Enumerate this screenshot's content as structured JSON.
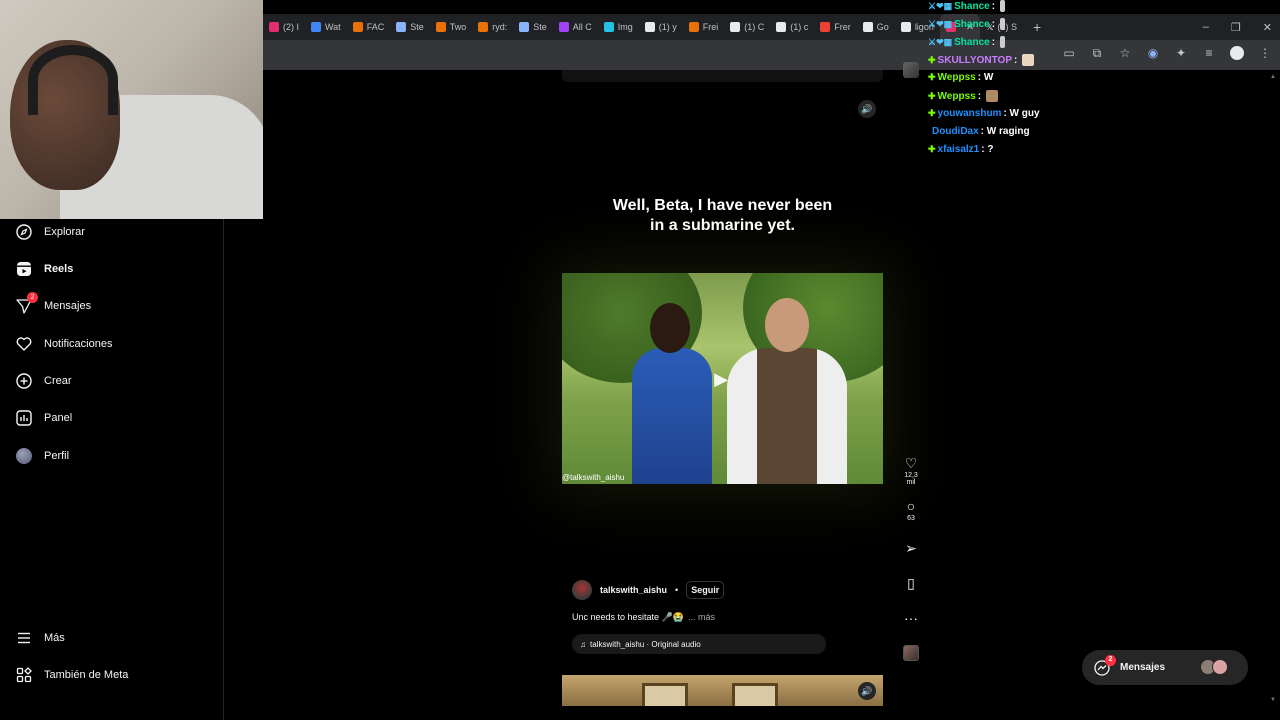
{
  "browser": {
    "tabs": [
      {
        "label": "(2) I",
        "color": "#e1306c"
      },
      {
        "label": "Wat",
        "color": "#4285f4"
      },
      {
        "label": "FAC",
        "color": "#e8710a"
      },
      {
        "label": "Ste",
        "color": "#8ab4f8"
      },
      {
        "label": "Two",
        "color": "#e8710a"
      },
      {
        "label": "ryd:",
        "color": "#e8710a"
      },
      {
        "label": "Ste",
        "color": "#8ab4f8"
      },
      {
        "label": "All C",
        "color": "#a142f4"
      },
      {
        "label": "Img",
        "color": "#24c1e0"
      },
      {
        "label": "(1) y",
        "color": "#e8eaed"
      },
      {
        "label": "Frei",
        "color": "#e8710a"
      },
      {
        "label": "(1) C",
        "color": "#e8eaed"
      },
      {
        "label": "(1) c",
        "color": "#e8eaed"
      },
      {
        "label": "Frer",
        "color": "#ea4335"
      },
      {
        "label": "Go",
        "color": "#e8eaed"
      },
      {
        "label": "ligon",
        "color": "#e8eaed"
      }
    ],
    "active_tab_color": "#e1306c",
    "last_tab": "(1) S",
    "new_tab": "+",
    "window_controls": [
      "–",
      "❐",
      "✕"
    ]
  },
  "sidebar": {
    "items": [
      {
        "label": "Explorar",
        "icon": "compass-icon"
      },
      {
        "label": "Reels",
        "icon": "reels-icon"
      },
      {
        "label": "Mensajes",
        "icon": "send-icon",
        "badge": "2"
      },
      {
        "label": "Notificaciones",
        "icon": "heart-icon"
      },
      {
        "label": "Crear",
        "icon": "plus-square-icon"
      },
      {
        "label": "Panel",
        "icon": "chart-icon"
      },
      {
        "label": "Perfil",
        "icon": "avatar"
      },
      {
        "label": "Más",
        "icon": "menu-icon"
      },
      {
        "label": "También de Meta",
        "icon": "meta-icon"
      }
    ]
  },
  "reel": {
    "caption_overlay": "Well, Beta, I have never been in a submarine yet.",
    "watermark": "@talkswith_aishu",
    "author": "talkswith_aishu",
    "follow": "Seguir",
    "separator": "•",
    "caption": "Unc needs to hesitate 🎤😭",
    "more": "... más",
    "audio": "talkswith_aishu · Original audio",
    "likes": "12,3 mil",
    "comments": "63"
  },
  "chat": {
    "lines": [
      {
        "user": "Shance",
        "color": "#00e5a0",
        "msg": ":"
      },
      {
        "user": "Shance",
        "color": "#00e5a0",
        "msg": ":"
      },
      {
        "user": "Shance",
        "color": "#00e5a0",
        "msg": ":"
      },
      {
        "user": "SKULLYONTOP",
        "color": "#c77dff",
        "msg": ":"
      },
      {
        "user": "Weppss",
        "color": "#7cfc00",
        "msg": ": W"
      },
      {
        "user": "Weppss",
        "color": "#7cfc00",
        "msg": ":"
      },
      {
        "user": "youwanshum",
        "color": "#1e90ff",
        "msg": ": W guy"
      },
      {
        "user": "DoudiDax",
        "color": "#1e90ff",
        "msg": ": W raging"
      },
      {
        "user": "xfaisalz1",
        "color": "#1e90ff",
        "msg": ": ?"
      }
    ]
  },
  "messages_float": {
    "label": "Mensajes",
    "badge": "2"
  }
}
